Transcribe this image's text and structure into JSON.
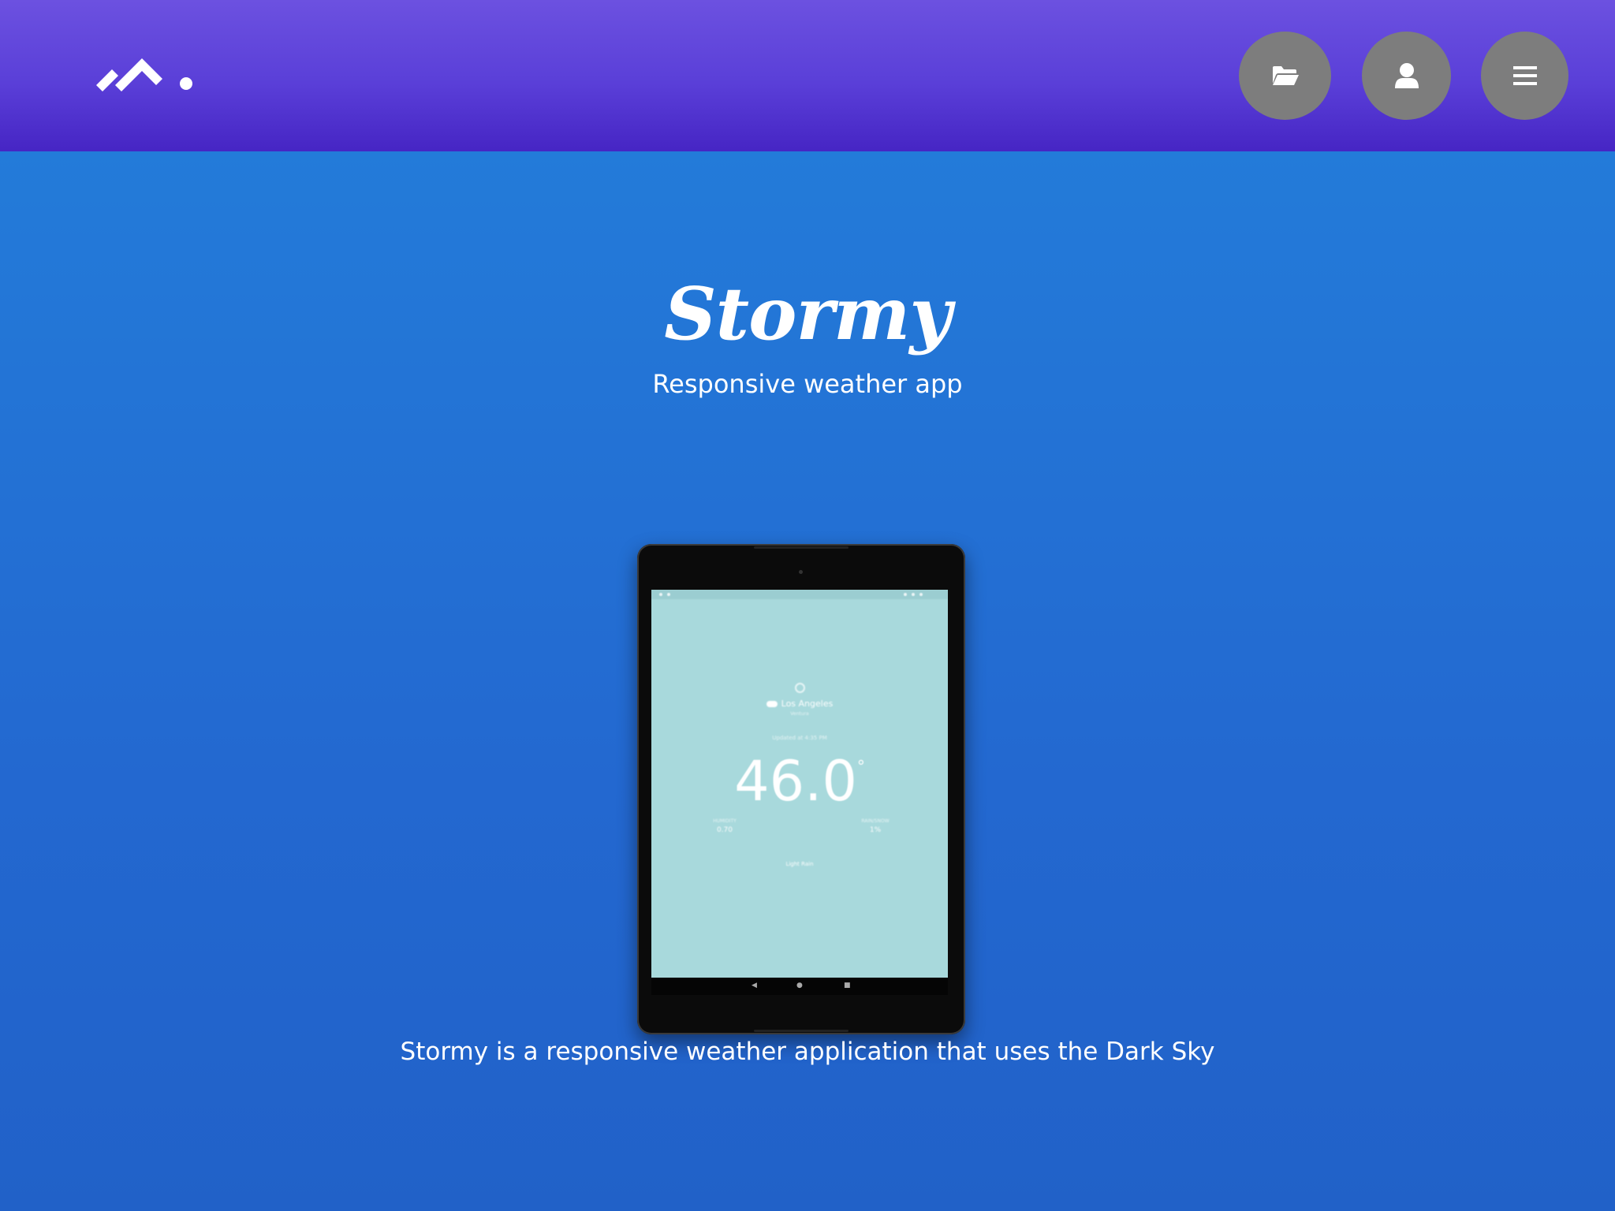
{
  "header": {
    "logo_icon": "brand-logo-icon",
    "buttons": [
      {
        "name": "projects",
        "icon": "folder-open-icon"
      },
      {
        "name": "profile",
        "icon": "user-icon"
      },
      {
        "name": "menu",
        "icon": "hamburger-menu-icon"
      }
    ],
    "colors": {
      "gradient_top": "#6c51e0",
      "gradient_bottom": "#4625c4",
      "button_bg": "#7d7d7d"
    }
  },
  "hero": {
    "title": "Stormy",
    "subtitle": "Responsive weather app",
    "background": "#236bd1"
  },
  "device_screen": {
    "location": "Los Angeles",
    "sublocation": "Ventura",
    "time_text": "Updated at 4:35 PM",
    "temperature": "46.0",
    "degree_symbol": "°",
    "stat_left_label": "HUMIDITY",
    "stat_left_value": "0.70",
    "stat_right_label": "RAIN/SNOW",
    "stat_right_value": "1%",
    "summary": "Light Rain",
    "screen_color": "#a8d9dc",
    "nav_back": "◀",
    "nav_home": "●",
    "nav_recent": "■"
  },
  "description": "Stormy is a responsive weather application that uses the Dark Sky"
}
